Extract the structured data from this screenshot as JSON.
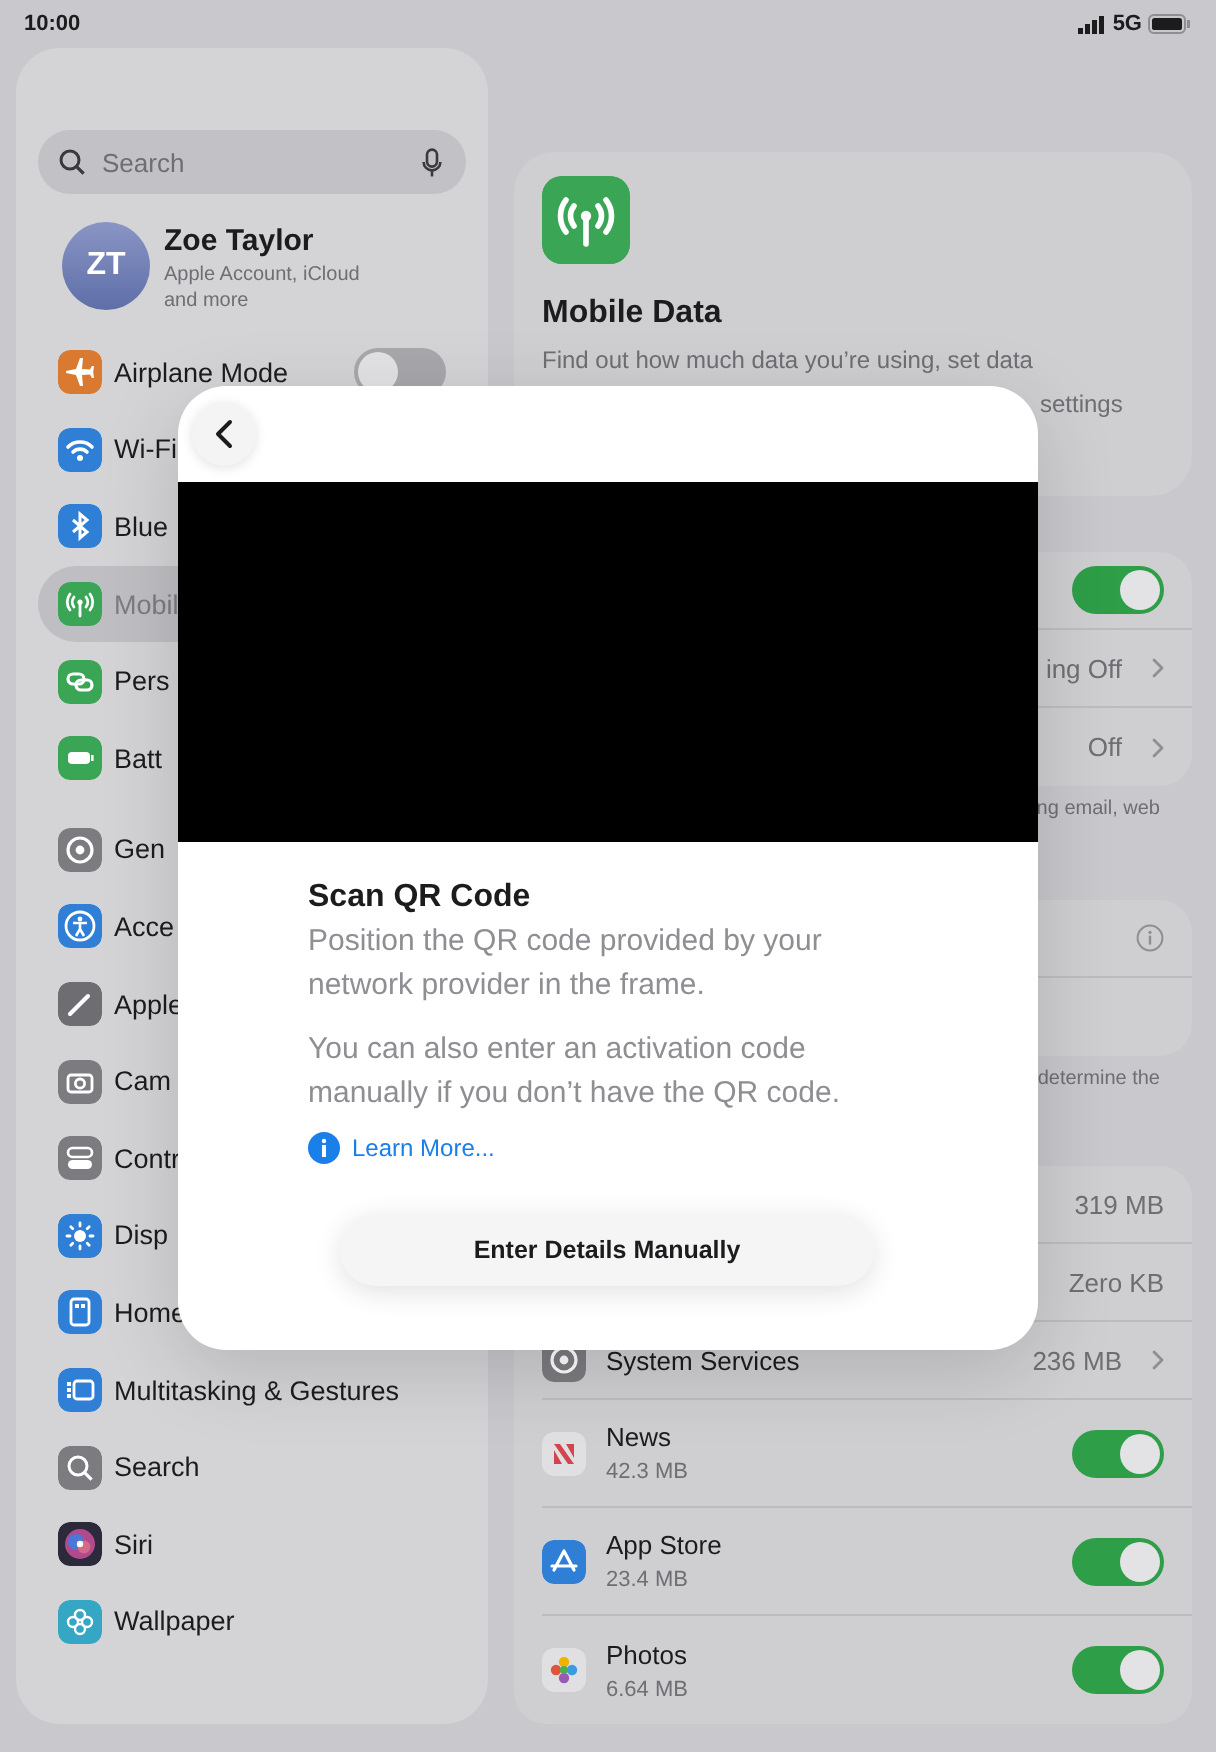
{
  "status_bar": {
    "time": "10:00",
    "network": "5G"
  },
  "sidebar": {
    "search": {
      "placeholder": "Search"
    },
    "profile": {
      "initials": "ZT",
      "name": "Zoe Taylor",
      "subtitle": "Apple Account, iCloud and more"
    },
    "groups": [
      [
        {
          "label": "Airplane Mode",
          "color": "#d97a30",
          "kind": "toggle",
          "on": false,
          "selected": false
        },
        {
          "label": "Wi-Fi",
          "color": "#2f7fd6",
          "kind": "link",
          "selected": false
        },
        {
          "label": "Blue",
          "color": "#2f7fd6",
          "kind": "link",
          "selected": false
        },
        {
          "label": "Mobil",
          "color": "#3aa655",
          "kind": "link",
          "selected": true
        },
        {
          "label": "Pers",
          "color": "#3aa655",
          "kind": "link",
          "selected": false
        },
        {
          "label": "Batt",
          "color": "#3aa655",
          "kind": "link",
          "selected": false
        }
      ],
      [
        {
          "label": "Gen",
          "color": "#7c7c80",
          "kind": "link",
          "selected": false
        },
        {
          "label": "Acce",
          "color": "#2f7fd6",
          "kind": "link",
          "selected": false
        },
        {
          "label": "Apple",
          "color": "#6e6e72",
          "kind": "link",
          "selected": false
        },
        {
          "label": "Cam",
          "color": "#7c7c80",
          "kind": "link",
          "selected": false
        },
        {
          "label": "Contr",
          "color": "#7c7c80",
          "kind": "link",
          "selected": false
        },
        {
          "label": "Disp",
          "color": "#2f7fd6",
          "kind": "link",
          "selected": false
        },
        {
          "label": "Home",
          "color": "#2f7fd6",
          "kind": "link",
          "selected": false
        },
        {
          "label": "Multitasking & Gestures",
          "color": "#2f7fd6",
          "kind": "link",
          "selected": false
        },
        {
          "label": "Search",
          "color": "#7c7c80",
          "kind": "link",
          "selected": false
        },
        {
          "label": "Siri",
          "color": "#2a2a3a",
          "kind": "link",
          "selected": false
        },
        {
          "label": "Wallpaper",
          "color": "#35a7c4",
          "kind": "link",
          "selected": false
        }
      ]
    ]
  },
  "content": {
    "header": {
      "title": "Mobile Data",
      "description": "Find out how much data you’re using, set data",
      "description_fragment": "settings"
    },
    "toggle_group": {
      "rows": [
        {
          "kind": "toggle",
          "on": true
        },
        {
          "kind": "value",
          "value": "ing Off",
          "chevron": true
        },
        {
          "kind": "value",
          "value": "Off",
          "chevron": true
        }
      ],
      "footnote": "ng email, web"
    },
    "info_group": {
      "rows": [
        {
          "kind": "info"
        },
        {
          "kind": "empty"
        }
      ],
      "footnote": "determine the"
    },
    "usage": {
      "rows": [
        {
          "kind": "value",
          "value": "319 MB",
          "chevron": false
        },
        {
          "kind": "value",
          "value": "Zero KB",
          "chevron": false
        },
        {
          "kind": "app",
          "label": "System Services",
          "value": "236 MB",
          "chevron": true,
          "color": "#7c7c80"
        },
        {
          "kind": "app_toggle",
          "label": "News",
          "detail": "42.3 MB",
          "on": true,
          "color": "#e0e0e3"
        },
        {
          "kind": "app_toggle",
          "label": "App Store",
          "detail": "23.4 MB",
          "on": true,
          "color": "#2f7fd6"
        },
        {
          "kind": "app_toggle",
          "label": "Photos",
          "detail": "6.64 MB",
          "on": true,
          "color": "#e0e0e3"
        }
      ]
    }
  },
  "modal": {
    "title": "Scan QR Code",
    "instructions": "Position the QR code provided by your network provider in the frame.",
    "alternative": "You can also enter an activation code manually if you don’t have the QR code.",
    "link": "Learn More...",
    "button": "Enter Details Manually"
  }
}
